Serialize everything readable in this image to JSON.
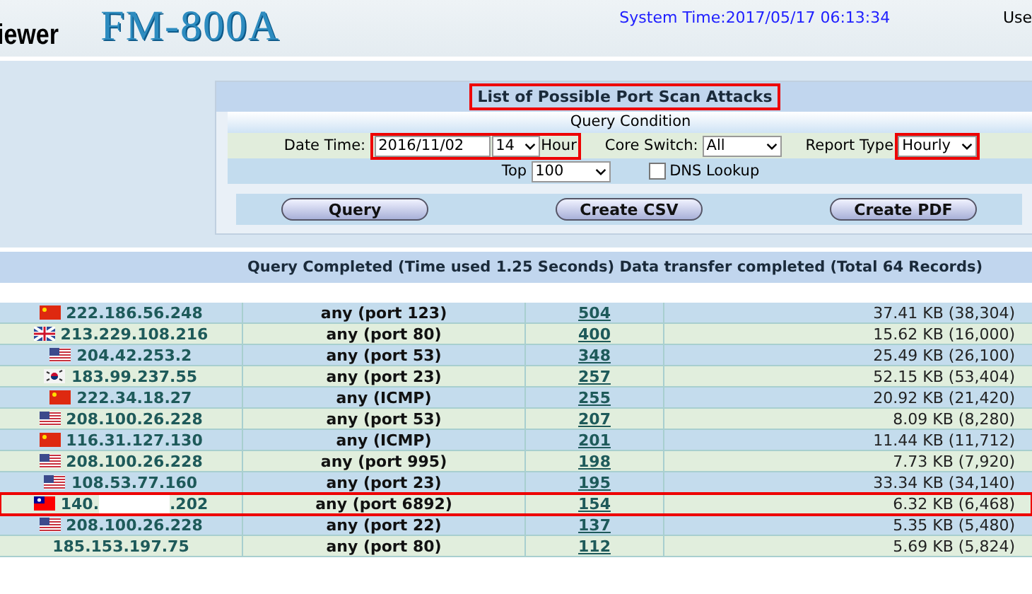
{
  "header": {
    "app_name": "iewer",
    "logo": "FM-800A",
    "system_time": "System Time:2017/05/17 06:13:34",
    "user": "Use"
  },
  "panel": {
    "title": "List of Possible Port Scan Attacks",
    "title_highlighted": true,
    "condition_title": "Query Condition",
    "date_label": "Date Time:",
    "date_value": "2016/11/02",
    "hour_value": "14",
    "hour_label": "Hour",
    "date_highlighted": true,
    "core_label": "Core Switch:",
    "core_value": "All",
    "report_label": "Report Type",
    "report_value": "Hourly",
    "report_highlighted": true,
    "top_label": "Top",
    "top_value": "100",
    "dns_label": "DNS Lookup",
    "dns_checked": false,
    "buttons": [
      "Query",
      "Create CSV",
      "Create PDF"
    ]
  },
  "status": "Query Completed (Time used 1.25 Seconds) Data transfer completed (Total 64 Records)",
  "table": {
    "rows": [
      {
        "flag": {
          "kind": "cn"
        },
        "ip": "222.186.56.248",
        "service": "any (port 123)",
        "count": "504",
        "bytes": "37.41 KB (38,304)",
        "highlighted": false
      },
      {
        "flag": {
          "kind": "gb"
        },
        "ip": "213.229.108.216",
        "service": "any (port 80)",
        "count": "400",
        "bytes": "15.62 KB (16,000)",
        "highlighted": false
      },
      {
        "flag": {
          "kind": "us"
        },
        "ip": "204.42.253.2",
        "service": "any (port 53)",
        "count": "348",
        "bytes": "25.49 KB (26,100)",
        "highlighted": false
      },
      {
        "flag": {
          "kind": "kr"
        },
        "ip": "183.99.237.55",
        "service": "any (port 23)",
        "count": "257",
        "bytes": "52.15 KB (53,404)",
        "highlighted": false
      },
      {
        "flag": {
          "kind": "cn"
        },
        "ip": "222.34.18.27",
        "service": "any (ICMP)",
        "count": "255",
        "bytes": "20.92 KB (21,420)",
        "highlighted": false
      },
      {
        "flag": {
          "kind": "us"
        },
        "ip": "208.100.26.228",
        "service": "any (port 53)",
        "count": "207",
        "bytes": "8.09 KB (8,280)",
        "highlighted": false
      },
      {
        "flag": {
          "kind": "cn"
        },
        "ip": "116.31.127.130",
        "service": "any (ICMP)",
        "count": "201",
        "bytes": "11.44 KB (11,712)",
        "highlighted": false
      },
      {
        "flag": {
          "kind": "us"
        },
        "ip": "208.100.26.228",
        "service": "any (port 995)",
        "count": "198",
        "bytes": "7.73 KB (7,920)",
        "highlighted": false
      },
      {
        "flag": {
          "kind": "us"
        },
        "ip": "108.53.77.160",
        "service": "any (port 23)",
        "count": "195",
        "bytes": "33.34 KB (34,140)",
        "highlighted": false
      },
      {
        "flag": {
          "kind": "tw"
        },
        "ip": "140.",
        "ip_suffix": ".202",
        "service": "any (port 6892)",
        "count": "154",
        "bytes": "6.32 KB (6,468)",
        "highlighted": true
      },
      {
        "flag": {
          "kind": "us"
        },
        "ip": "208.100.26.228",
        "service": "any (port 22)",
        "count": "137",
        "bytes": "5.35 KB (5,480)",
        "highlighted": false
      },
      {
        "ip": "185.153.197.75",
        "service": "any (port 80)",
        "count": "112",
        "bytes": "5.69 KB (5,824)",
        "highlighted": false
      }
    ]
  }
}
